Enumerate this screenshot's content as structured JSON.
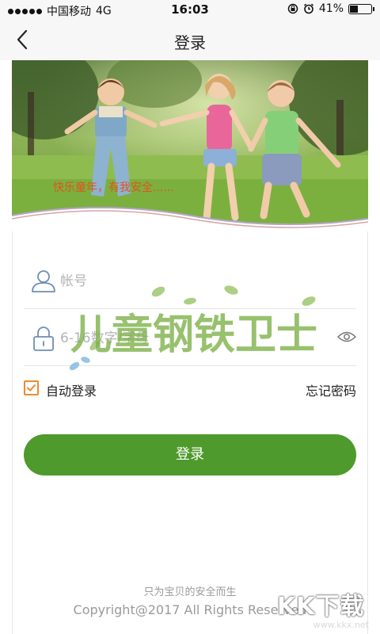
{
  "status_bar": {
    "carrier": "中国移动",
    "network": "4G",
    "time": "16:03",
    "battery": "41%",
    "battery_level": 0.41
  },
  "nav": {
    "title": "登录",
    "back_icon": "chevron-left-icon"
  },
  "banner": {
    "slogan": "快乐童年，有我安全......"
  },
  "form": {
    "account": {
      "placeholder": "帐号",
      "value": "",
      "icon": "user-icon"
    },
    "password": {
      "placeholder": "6-16数字/字母",
      "value": "",
      "icon": "lock-icon",
      "toggle_icon": "eye-icon"
    },
    "auto_login": {
      "label": "自动登录",
      "checked": true
    },
    "forgot_password": "忘记密码",
    "login_button": "登录"
  },
  "watermark": "儿童钢铁卫士",
  "footer": {
    "slogan": "只为宝贝的安全而生",
    "copyright": "Copyright@2017 All Rights Reserved"
  },
  "corner_logo": {
    "text": "KK下载",
    "url": "www.kkx.net"
  },
  "colors": {
    "primary_green": "#4e9a2c",
    "checkbox_orange": "#ef8a31",
    "slogan_orange": "#e2531d",
    "icon_blue": "#6e8fb3"
  }
}
